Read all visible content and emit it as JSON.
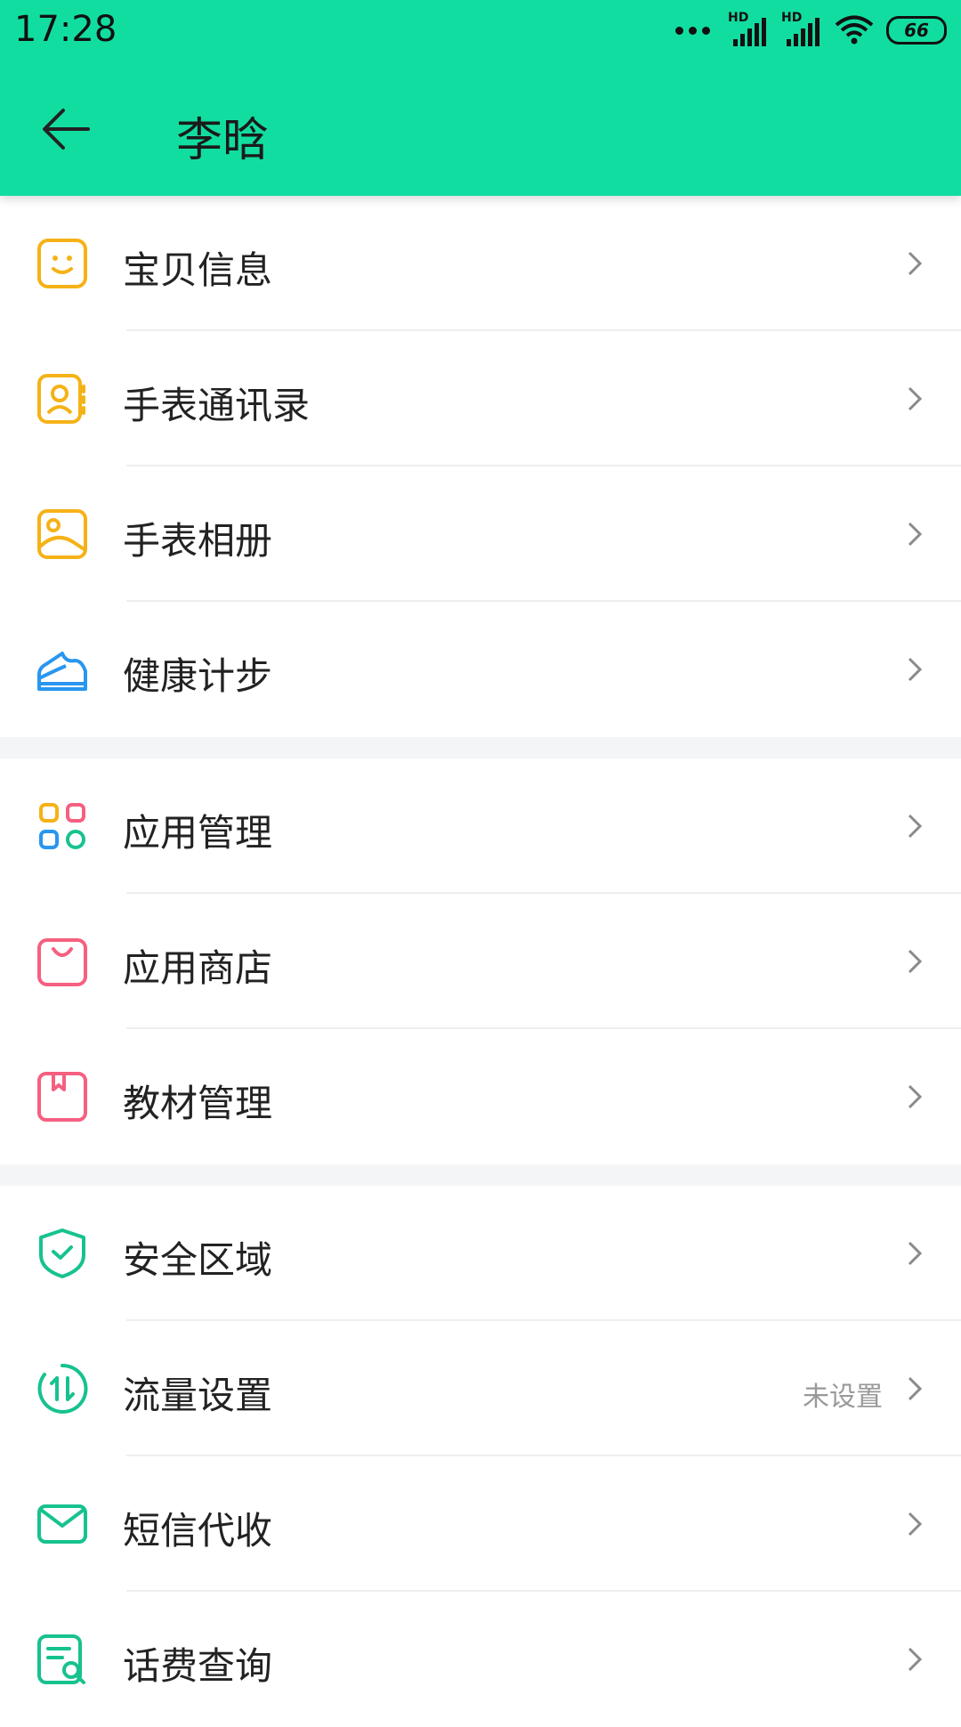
{
  "status_bar": {
    "time": "17:28",
    "signal_1_label": "HD",
    "signal_2_label": "HD",
    "battery": "66"
  },
  "header": {
    "title": "李晗",
    "back_icon": "arrow-left-icon",
    "background_color": "#12dda0"
  },
  "sections": [
    [
      {
        "label": "宝贝信息",
        "icon": "smile-face-icon",
        "color": "#f5b217"
      },
      {
        "label": "手表通讯录",
        "icon": "contacts-book-icon",
        "color": "#f5b217"
      },
      {
        "label": "手表相册",
        "icon": "photo-album-icon",
        "color": "#f5b217"
      },
      {
        "label": "健康计步",
        "icon": "shoe-icon",
        "color": "#2996f0"
      }
    ],
    [
      {
        "label": "应用管理",
        "icon": "apps-grid-icon",
        "color": "#f56080"
      },
      {
        "label": "应用商店",
        "icon": "shopping-bag-icon",
        "color": "#f56080"
      },
      {
        "label": "教材管理",
        "icon": "book-icon",
        "color": "#f56080"
      }
    ],
    [
      {
        "label": "安全区域",
        "icon": "shield-check-icon",
        "color": "#17c28f"
      },
      {
        "label": "流量设置",
        "icon": "data-traffic-icon",
        "color": "#17c28f",
        "value": "未设置"
      },
      {
        "label": "短信代收",
        "icon": "envelope-icon",
        "color": "#17c28f"
      },
      {
        "label": "话费查询",
        "icon": "bill-search-icon",
        "color": "#17c28f"
      }
    ]
  ]
}
